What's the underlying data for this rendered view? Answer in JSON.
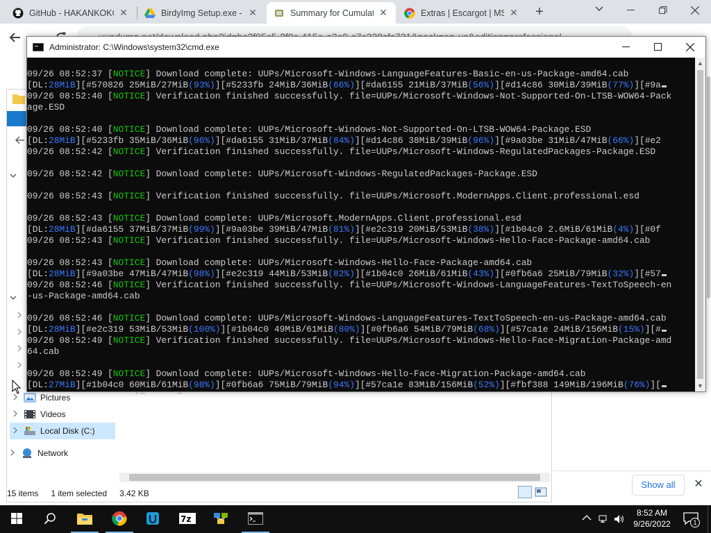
{
  "browser": {
    "tabs": [
      {
        "label": "GitHub - HAKANKOKC",
        "icon": "github-icon"
      },
      {
        "label": "BirdyImg Setup.exe - G",
        "icon": "google-drive-icon"
      },
      {
        "label": "Summary for Cumulati",
        "icon": "uup-dump-icon",
        "active": true
      },
      {
        "label": "Extras | Escargot | MSN",
        "icon": "chrome-icon"
      }
    ],
    "new_tab": "+",
    "url": "uupdump.net/download.php?id=bc2f95c5-2f9c-415e-a3e9-c7c330cfc731&pack=en-us&edition=professional"
  },
  "explorer": {
    "tree": [
      {
        "label": "Pictures"
      },
      {
        "label": "Videos"
      },
      {
        "label": "Local Disk (C:)",
        "selected": true
      },
      {
        "label": "Network"
      }
    ],
    "file_list_fragment": "uup_download_windows",
    "status": {
      "items": "15 items",
      "selected": "1 item selected",
      "size": "3.42 KB"
    }
  },
  "download_bar": {
    "show_all": "Show all"
  },
  "cmd": {
    "title": "Administrator: C:\\Windows\\system32\\cmd.exe",
    "lines": [
      [
        {
          "t": "09/26 08:52:37 [",
          "c": ""
        },
        {
          "t": "NOTICE",
          "c": "g"
        },
        {
          "t": "] Download complete: UUPs/Microsoft-Windows-LanguageFeatures-Basic-en-us-Package-amd64.cab",
          "c": ""
        }
      ],
      [
        {
          "t": "[",
          "c": ""
        },
        {
          "t": "DL:",
          "c": ""
        },
        {
          "t": "28MiB",
          "c": "b"
        },
        {
          "t": "][#570826 25MiB/27MiB",
          "c": ""
        },
        {
          "t": "(93%)",
          "c": "b"
        },
        {
          "t": "][#5233fb 24MiB/36MiB",
          "c": ""
        },
        {
          "t": "(66%)",
          "c": "b"
        },
        {
          "t": "][#da6155 21MiB/37MiB",
          "c": ""
        },
        {
          "t": "(56%)",
          "c": "b"
        },
        {
          "t": "][#d14c86 30MiB/39MiB",
          "c": ""
        },
        {
          "t": "(77%)",
          "c": "b"
        },
        {
          "t": "][#9a",
          "c": ""
        },
        {
          "t": "cursor",
          "c": "cur"
        }
      ],
      [
        {
          "t": "09/26 08:52:40 [",
          "c": ""
        },
        {
          "t": "NOTICE",
          "c": "g"
        },
        {
          "t": "] Verification finished successfully. file=UUPs/Microsoft-Windows-Not-Supported-On-LTSB-WOW64-Pack",
          "c": ""
        }
      ],
      [
        {
          "t": "age.ESD",
          "c": ""
        }
      ],
      [],
      [
        {
          "t": "09/26 08:52:40 [",
          "c": ""
        },
        {
          "t": "NOTICE",
          "c": "g"
        },
        {
          "t": "] Download complete: UUPs/Microsoft-Windows-Not-Supported-On-LTSB-WOW64-Package.ESD",
          "c": ""
        }
      ],
      [
        {
          "t": "[",
          "c": ""
        },
        {
          "t": "DL:",
          "c": ""
        },
        {
          "t": "28MiB",
          "c": "b"
        },
        {
          "t": "][#5233fb 35MiB/36MiB",
          "c": ""
        },
        {
          "t": "(96%)",
          "c": "b"
        },
        {
          "t": "][#da6155 31MiB/37MiB",
          "c": ""
        },
        {
          "t": "(84%)",
          "c": "b"
        },
        {
          "t": "][#d14c86 38MiB/39MiB",
          "c": ""
        },
        {
          "t": "(96%)",
          "c": "b"
        },
        {
          "t": "][#9a03be 31MiB/47MiB",
          "c": ""
        },
        {
          "t": "(66%)",
          "c": "b"
        },
        {
          "t": "][#e2",
          "c": ""
        }
      ],
      [
        {
          "t": "09/26 08:52:42 [",
          "c": ""
        },
        {
          "t": "NOTICE",
          "c": "g"
        },
        {
          "t": "] Verification finished successfully. file=UUPs/Microsoft-Windows-RegulatedPackages-Package.ESD",
          "c": ""
        }
      ],
      [],
      [
        {
          "t": "09/26 08:52:42 [",
          "c": ""
        },
        {
          "t": "NOTICE",
          "c": "g"
        },
        {
          "t": "] Download complete: UUPs/Microsoft-Windows-RegulatedPackages-Package.ESD",
          "c": ""
        }
      ],
      [],
      [
        {
          "t": "09/26 08:52:43 [",
          "c": ""
        },
        {
          "t": "NOTICE",
          "c": "g"
        },
        {
          "t": "] Verification finished successfully. file=UUPs/Microsoft.ModernApps.Client.professional.esd",
          "c": ""
        }
      ],
      [],
      [
        {
          "t": "09/26 08:52:43 [",
          "c": ""
        },
        {
          "t": "NOTICE",
          "c": "g"
        },
        {
          "t": "] Download complete: UUPs/Microsoft.ModernApps.Client.professional.esd",
          "c": ""
        }
      ],
      [
        {
          "t": "[",
          "c": ""
        },
        {
          "t": "DL:",
          "c": ""
        },
        {
          "t": "28MiB",
          "c": "b"
        },
        {
          "t": "][#da6155 37MiB/37MiB",
          "c": ""
        },
        {
          "t": "(99%)",
          "c": "b"
        },
        {
          "t": "][#9a03be 39MiB/47MiB",
          "c": ""
        },
        {
          "t": "(81%)",
          "c": "b"
        },
        {
          "t": "][#e2c319 20MiB/53MiB",
          "c": ""
        },
        {
          "t": "(38%)",
          "c": "b"
        },
        {
          "t": "][#1b04c0 2.6MiB/61MiB",
          "c": ""
        },
        {
          "t": "(4%)",
          "c": "b"
        },
        {
          "t": "][#0f",
          "c": ""
        }
      ],
      [
        {
          "t": "09/26 08:52:43 [",
          "c": ""
        },
        {
          "t": "NOTICE",
          "c": "g"
        },
        {
          "t": "] Verification finished successfully. file=UUPs/Microsoft-Windows-Hello-Face-Package-amd64.cab",
          "c": ""
        }
      ],
      [],
      [
        {
          "t": "09/26 08:52:43 [",
          "c": ""
        },
        {
          "t": "NOTICE",
          "c": "g"
        },
        {
          "t": "] Download complete: UUPs/Microsoft-Windows-Hello-Face-Package-amd64.cab",
          "c": ""
        }
      ],
      [
        {
          "t": "[",
          "c": ""
        },
        {
          "t": "DL:",
          "c": ""
        },
        {
          "t": "28MiB",
          "c": "b"
        },
        {
          "t": "][#9a03be 47MiB/47MiB",
          "c": ""
        },
        {
          "t": "(98%)",
          "c": "b"
        },
        {
          "t": "][#e2c319 44MiB/53MiB",
          "c": ""
        },
        {
          "t": "(82%)",
          "c": "b"
        },
        {
          "t": "][#1b04c0 26MiB/61MiB",
          "c": ""
        },
        {
          "t": "(43%)",
          "c": "b"
        },
        {
          "t": "][#0fb6a6 25MiB/79MiB",
          "c": ""
        },
        {
          "t": "(32%)",
          "c": "b"
        },
        {
          "t": "][#57",
          "c": ""
        },
        {
          "t": "cursor",
          "c": "cur"
        }
      ],
      [
        {
          "t": "09/26 08:52:46 [",
          "c": ""
        },
        {
          "t": "NOTICE",
          "c": "g"
        },
        {
          "t": "] Verification finished successfully. file=UUPs/Microsoft-Windows-LanguageFeatures-TextToSpeech-en",
          "c": ""
        }
      ],
      [
        {
          "t": "-us-Package-amd64.cab",
          "c": ""
        }
      ],
      [],
      [
        {
          "t": "09/26 08:52:46 [",
          "c": ""
        },
        {
          "t": "NOTICE",
          "c": "g"
        },
        {
          "t": "] Download complete: UUPs/Microsoft-Windows-LanguageFeatures-TextToSpeech-en-us-Package-amd64.cab",
          "c": ""
        }
      ],
      [
        {
          "t": "[",
          "c": ""
        },
        {
          "t": "DL:",
          "c": ""
        },
        {
          "t": "28MiB",
          "c": "b"
        },
        {
          "t": "][#e2c319 53MiB/53MiB",
          "c": ""
        },
        {
          "t": "(100%)",
          "c": "b"
        },
        {
          "t": "][#1b04c0 49MiB/61MiB",
          "c": ""
        },
        {
          "t": "(80%)",
          "c": "b"
        },
        {
          "t": "][#0fb6a6 54MiB/79MiB",
          "c": ""
        },
        {
          "t": "(68%)",
          "c": "b"
        },
        {
          "t": "][#57ca1e 24MiB/156MiB",
          "c": ""
        },
        {
          "t": "(15%)",
          "c": "b"
        },
        {
          "t": "][#",
          "c": ""
        },
        {
          "t": "cursor",
          "c": "cur"
        }
      ],
      [
        {
          "t": "09/26 08:52:49 [",
          "c": ""
        },
        {
          "t": "NOTICE",
          "c": "g"
        },
        {
          "t": "] Verification finished successfully. file=UUPs/Microsoft-Windows-Hello-Face-Migration-Package-amd",
          "c": ""
        }
      ],
      [
        {
          "t": "64.cab",
          "c": ""
        }
      ],
      [],
      [
        {
          "t": "09/26 08:52:49 [",
          "c": ""
        },
        {
          "t": "NOTICE",
          "c": "g"
        },
        {
          "t": "] Download complete: UUPs/Microsoft-Windows-Hello-Face-Migration-Package-amd64.cab",
          "c": ""
        }
      ],
      [
        {
          "t": "[",
          "c": ""
        },
        {
          "t": "DL:",
          "c": ""
        },
        {
          "t": "27MiB",
          "c": "b"
        },
        {
          "t": "][#1b04c0 60MiB/61MiB",
          "c": ""
        },
        {
          "t": "(98%)",
          "c": "b"
        },
        {
          "t": "][#0fb6a6 75MiB/79MiB",
          "c": ""
        },
        {
          "t": "(94%)",
          "c": "b"
        },
        {
          "t": "][#57ca1e 83MiB/156MiB",
          "c": ""
        },
        {
          "t": "(52%)",
          "c": "b"
        },
        {
          "t": "][#fbf388 149MiB/196MiB",
          "c": ""
        },
        {
          "t": "(76%)",
          "c": "b"
        },
        {
          "t": "][",
          "c": ""
        },
        {
          "t": "cursor",
          "c": "cur"
        }
      ]
    ]
  },
  "taskbar": {
    "apps": [
      "start-icon",
      "search-icon",
      "file-explorer-icon",
      "chrome-icon",
      "uupdump-app-icon",
      "7zip-icon",
      "network-app-icon",
      "cmd-icon"
    ],
    "clock_time": "8:52 AM",
    "clock_date": "9/26/2022",
    "notification_count": "1"
  },
  "colors": {
    "notice": "#16c60c",
    "highlight": "#3b78ff",
    "console_bg": "#0c0c0c",
    "taskbar_bg": "#101010"
  }
}
